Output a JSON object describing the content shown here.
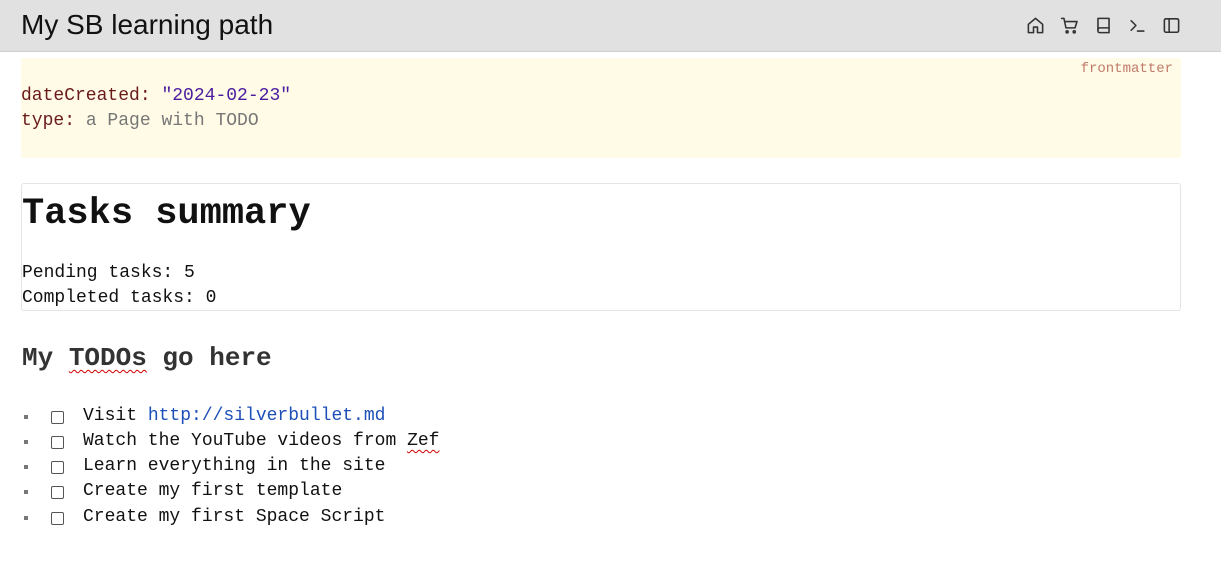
{
  "page": {
    "title": "My SB learning path"
  },
  "toolbar": {
    "buttons": [
      {
        "name": "home-icon"
      },
      {
        "name": "cart-icon"
      },
      {
        "name": "book-icon"
      },
      {
        "name": "terminal-icon"
      },
      {
        "name": "sidebar-icon"
      }
    ]
  },
  "frontmatter": {
    "label": "frontmatter",
    "date_key": "dateCreated:",
    "date_value": "\"2024-02-23\"",
    "type_key": "type:",
    "type_value": "a Page with TODO"
  },
  "summary": {
    "title": "Tasks summary",
    "pending": "Pending tasks: 5",
    "completed": "Completed tasks: 0"
  },
  "todos": {
    "heading_pre": "My ",
    "heading_spell": "TODOs",
    "heading_post": " go here",
    "items": [
      {
        "prefix": "Visit ",
        "link": "http://silverbullet.md",
        "checked": false
      },
      {
        "prefix": "Watch the YouTube videos from ",
        "spell": "Zef",
        "checked": false
      },
      {
        "text": "Learn everything in the site",
        "checked": false
      },
      {
        "text": "Create my first template",
        "checked": false
      },
      {
        "text": "Create my first Space Script",
        "checked": false
      }
    ]
  },
  "colors": {
    "topbar_bg": "#e1e1e1",
    "frontmatter_bg": "#fffbe6",
    "link": "#1d4fb8",
    "spellcheck": "#d40000"
  }
}
